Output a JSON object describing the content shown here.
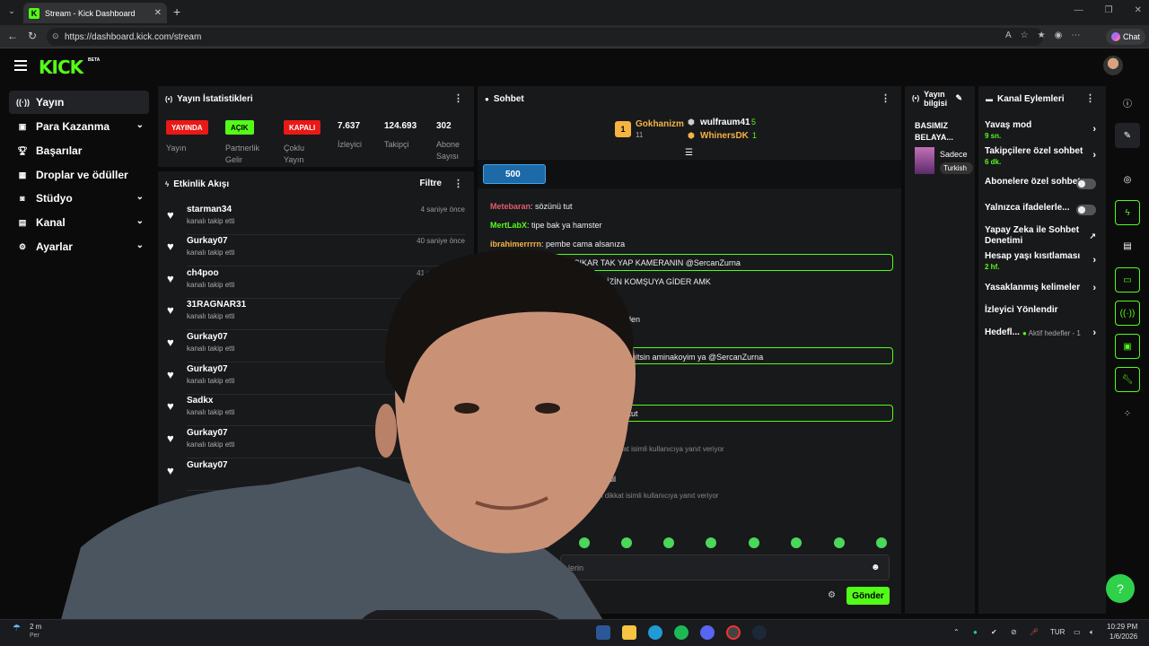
{
  "browser": {
    "tab_title": "Stream - Kick Dashboard",
    "tab_close": "✕",
    "new_tab": "+",
    "url": "https://dashboard.kick.com/stream",
    "chat_button": "Chat"
  },
  "app": {
    "logo": "KICK",
    "beta": "BETA"
  },
  "sidebar": {
    "items": [
      {
        "label": "Yayın",
        "icon": "broadcast-icon"
      },
      {
        "label": "Para Kazanma",
        "icon": "wallet-icon"
      },
      {
        "label": "Başarılar",
        "icon": "trophy-icon"
      },
      {
        "label": "Droplar ve ödüller",
        "icon": "gift-icon"
      },
      {
        "label": "Stüdyo",
        "icon": "studio-icon"
      },
      {
        "label": "Kanal",
        "icon": "channel-icon"
      },
      {
        "label": "Ayarlar",
        "icon": "gear-icon"
      }
    ]
  },
  "stats": {
    "title": "Yayın İstatistikleri",
    "badges": [
      {
        "text": "YAYINDA",
        "label": "Yayın",
        "color": "#e91916"
      },
      {
        "text": "AÇIK",
        "label": "Partnerlik Gelir",
        "color": "#53fc18"
      },
      {
        "text": "KAPALI",
        "label": "Çoklu Yayın",
        "color": "#e91916"
      }
    ],
    "values": [
      {
        "value": "7.637",
        "label": "İzleyici"
      },
      {
        "value": "124.693",
        "label": "Takipçi"
      },
      {
        "value": "302",
        "label": "Abone Sayısı"
      }
    ]
  },
  "activity": {
    "title": "Etkinlik Akışı",
    "filter": "Filtre",
    "items": [
      {
        "name": "starman34",
        "sub": "kanalı takip etti",
        "time": "4 saniye önce"
      },
      {
        "name": "Gurkay07",
        "sub": "kanalı takip etti",
        "time": "40 saniye önce"
      },
      {
        "name": "ch4poo",
        "sub": "kanalı takip etti",
        "time": "41 saniye önce"
      },
      {
        "name": "31RAGNAR31",
        "sub": "kanalı takip etti",
        "time": "41"
      },
      {
        "name": "Gurkay07",
        "sub": "kanalı takip etti",
        "time": ""
      },
      {
        "name": "Gurkay07",
        "sub": "kanalı takip etti",
        "time": ""
      },
      {
        "name": "Sadkx",
        "sub": "kanalı takip etti",
        "time": ""
      },
      {
        "name": "Gurkay07",
        "sub": "kanalı takip etti",
        "time": ""
      },
      {
        "name": "Gurkay07",
        "sub": "",
        "time": ""
      }
    ]
  },
  "chat": {
    "title": "Sohbet",
    "leaders": [
      {
        "name": "Gokhanizm",
        "count": "11"
      },
      {
        "name": "wulfraum41",
        "count": "5"
      },
      {
        "name": "WhinersDK",
        "count": "1"
      }
    ],
    "rank_badge": "1",
    "gift_amount": "500",
    "messages": [
      {
        "user": "Metebaran",
        "text": ": sözünü tut",
        "color": "#e35d6a"
      },
      {
        "user": "MertLabX",
        "text": ": tipe bak ya hamster",
        "color": "#53fc18"
      },
      {
        "user": "ibrahimerrrrn",
        "text": ": pembe cama alsanıza",
        "color": "#f5b342"
      }
    ],
    "partial": [
      "YU ÇIKAR TAK YAP KAMERANIN @SercanZurna",
      "AM SİZİN KOMŞUYA GİDER AMK",
      "n evden",
      "gitsin aminakoyim ya @SercanZurna",
      "nü tut",
      "dikkat isimli kullanıcıya yanıt veriyor",
      "edil",
      "m dikkat isimli kullanıcıya yanıt veriyor"
    ],
    "input_placeholder": "lerin",
    "send": "Gönder"
  },
  "stream_info": {
    "title": "Yayın bilgisi",
    "stream_title": "BASIMIZ BELAYA...",
    "category": "Sadece",
    "tag": "Turkish"
  },
  "channel_actions": {
    "title": "Kanal Eylemleri",
    "items": [
      {
        "label": "Yavaş mod",
        "sub": "9 sn."
      },
      {
        "label": "Takipçilere özel sohbet",
        "sub": "6 dk."
      },
      {
        "label": "Abonelere özel sohbet",
        "sub": ""
      },
      {
        "label": "Yalnızca ifadelerle...",
        "sub": ""
      },
      {
        "label": "Yapay Zeka ile Sohbet Denetimi",
        "sub": ""
      },
      {
        "label": "Hesap yaşı kısıtlaması",
        "sub": "2 hf."
      },
      {
        "label": "Yasaklanmış kelimeler",
        "sub": ""
      },
      {
        "label": "İzleyici Yönlendir",
        "sub": ""
      },
      {
        "label": "Hedefl...",
        "sub": "Aktif hedefler - 1"
      }
    ]
  },
  "taskbar": {
    "weather": "2 m",
    "weather_sub": "Per",
    "lang": "TUR",
    "time": "10:29 PM",
    "date": "1/6/2026"
  },
  "colors": {
    "accent": "#53fc18",
    "panel": "#18191b",
    "live": "#e91916"
  }
}
